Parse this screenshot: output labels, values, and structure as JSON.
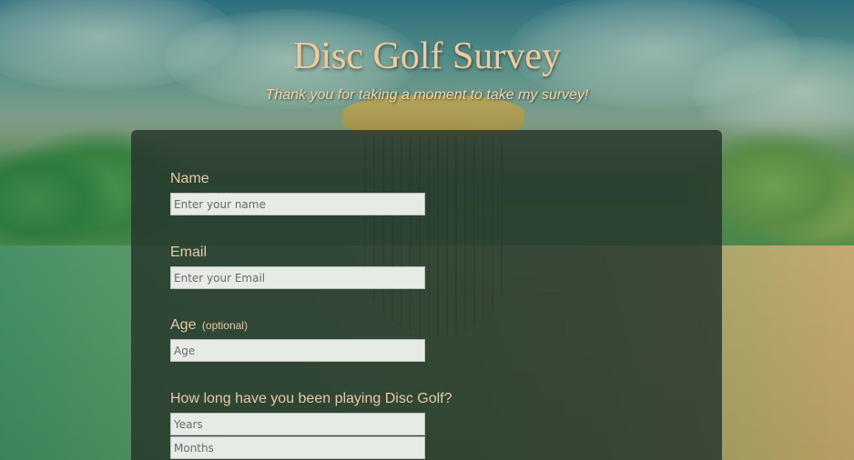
{
  "header": {
    "title": "Disc Golf Survey",
    "subtitle": "Thank you for taking a moment to take my survey!"
  },
  "form": {
    "name": {
      "label": "Name",
      "placeholder": "Enter your name",
      "value": ""
    },
    "email": {
      "label": "Email",
      "placeholder": "Enter your Email",
      "value": ""
    },
    "age": {
      "label": "Age",
      "optional_note": "(optional)",
      "placeholder": "Age",
      "value": ""
    },
    "experience": {
      "label": "How long have you been playing Disc Golf?",
      "years_placeholder": "Years",
      "months_placeholder": "Months"
    }
  },
  "colors": {
    "title_text": "#f4c99a",
    "label_text": "#e8c9a3",
    "panel_bg": "#26342c",
    "input_bg": "#e6ebe6"
  }
}
